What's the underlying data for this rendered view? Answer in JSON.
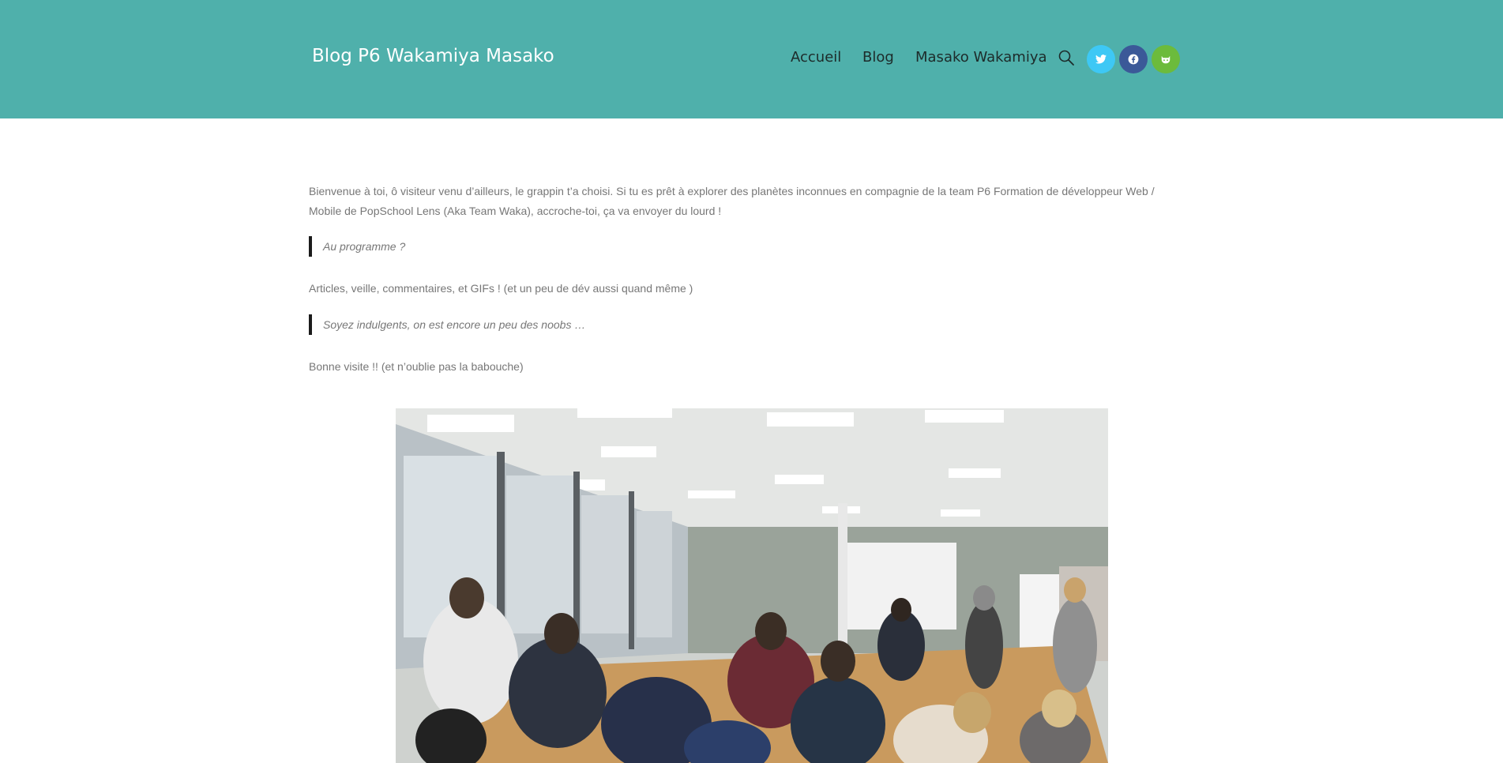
{
  "site": {
    "title": "Blog P6 Wakamiya Masako"
  },
  "nav": {
    "items": [
      {
        "label": "Accueil"
      },
      {
        "label": "Blog"
      },
      {
        "label": "Masako Wakamiya"
      }
    ],
    "search_icon": "search-icon"
  },
  "social": [
    {
      "name": "twitter",
      "icon": "twitter-icon",
      "color": "#3ec8f5"
    },
    {
      "name": "facebook",
      "icon": "facebook-icon",
      "color": "#3b5998"
    },
    {
      "name": "github",
      "icon": "github-icon",
      "color": "#6cbb3c"
    }
  ],
  "colors": {
    "header_bg": "#4fb0ab",
    "text": "#777777",
    "quote_bar": "#1b1b1b"
  },
  "content": {
    "intro": "Bienvenue à toi, ô visiteur venu d’ailleurs, le grappin t’a choisi. Si tu es prêt à explorer des planètes inconnues en compagnie de la team P6 Formation de développeur Web / Mobile de PopSchool Lens (Aka Team Waka), accroche-toi, ça va envoyer du lourd !",
    "quote1": "Au programme ?",
    "line2": "Articles, veille,  commentaires, et GIFs ! (et un peu de dév aussi quand même )",
    "quote2": "Soyez indulgents, on est encore un peu des noobs …",
    "line3": "Bonne visite !! (et n’oublie pas la babouche)"
  }
}
